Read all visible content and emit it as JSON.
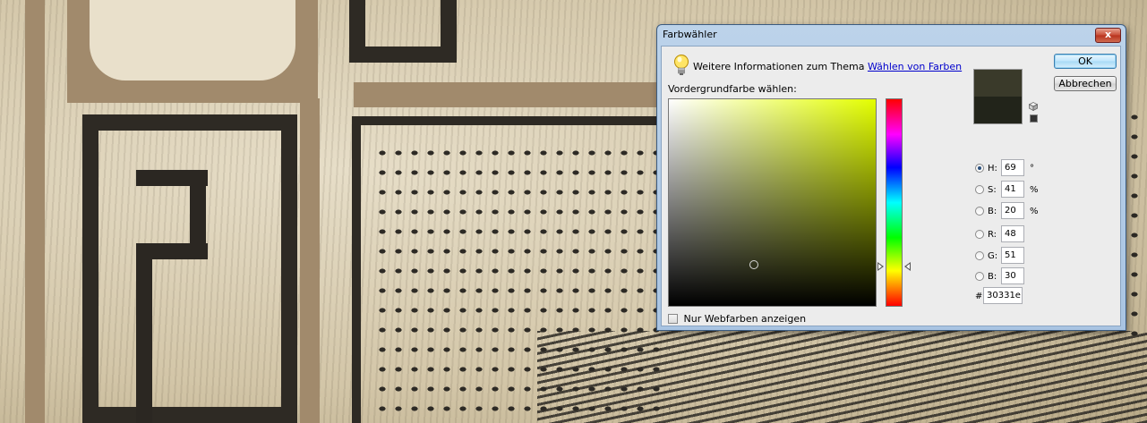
{
  "window": {
    "title": "Farbwähler",
    "close_glyph": "x"
  },
  "info": {
    "icon": "lightbulb-icon",
    "text": "Weitere Informationen zum Thema",
    "link": "Wählen von Farben"
  },
  "picker": {
    "label": "Vordergrundfarbe wählen:",
    "hue_color": "#e4ff00",
    "web_colors_label": "Nur Webfarben anzeigen",
    "web_colors_checked": false
  },
  "swatch": {
    "new_color": "#3a3a2a",
    "current_color": "#22241a"
  },
  "buttons": {
    "ok": "OK",
    "cancel": "Abbrechen"
  },
  "fields": {
    "h": {
      "label": "H:",
      "value": "69",
      "unit": "°",
      "selected": true
    },
    "s": {
      "label": "S:",
      "value": "41",
      "unit": "%",
      "selected": false
    },
    "b": {
      "label": "B:",
      "value": "20",
      "unit": "%",
      "selected": false
    },
    "r": {
      "label": "R:",
      "value": "48",
      "selected": false
    },
    "g": {
      "label": "G:",
      "value": "51",
      "selected": false
    },
    "b2": {
      "label": "B:",
      "value": "30",
      "selected": false
    },
    "hex": {
      "label": "#",
      "value": "30331e"
    }
  }
}
